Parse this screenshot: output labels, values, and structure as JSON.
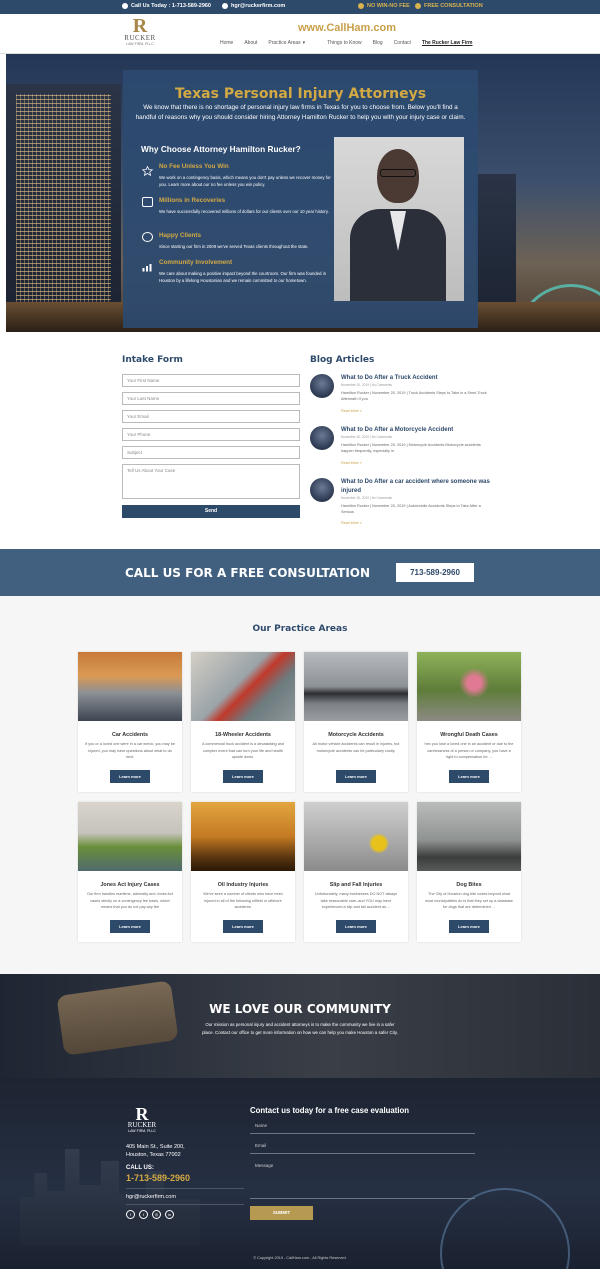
{
  "topbar": {
    "call_today": "Call Us Today : 1-713-589-2960",
    "email": "hgr@ruckerfirm.com",
    "no_win": "NO WIN-NO FEE",
    "free_consult": "FREE CONSULTATION"
  },
  "header": {
    "logo_mark": "R",
    "logo_name": "RUCKER",
    "logo_sub": "LAW FIRM, PLLC",
    "site": "www.CallHam.com",
    "nav": [
      "Home",
      "About",
      "Practice Areas",
      "Things to Know",
      "Blog",
      "Contact",
      "The Rucker Law Firm"
    ],
    "nav_caret": "▾"
  },
  "hero": {
    "title": "Texas Personal Injury Attorneys",
    "intro": "We know that there is no shortage of personal injury law firms in Texas for you to choose from. Below you'll find a handful of reasons why you should consider hiring Attorney Hamilton Rucker to help you with your injury case or claim.",
    "why": "Why Choose Attorney Hamilton Rucker?",
    "features": [
      {
        "title": "No Fee Unless You Win",
        "desc": "We work on a contingency basis, which means you don't pay unless we recover money for you. Learn more about our no fee unless you win policy."
      },
      {
        "title": "Millions in Recoveries",
        "desc": "We have successfully recovered millions of dollars for our clients over our 10 year history."
      },
      {
        "title": "Happy Clients",
        "desc": "Since starting our firm in 2009 we've served Texas clients throughout the state."
      },
      {
        "title": "Community Involvement",
        "desc": "We care about making a positive impact beyond the courtroom. Our firm was founded in Houston by a lifelong Houstonian and we remain committed to our hometown."
      }
    ]
  },
  "intake": {
    "heading": "Intake Form",
    "first_name": "Your First Name",
    "last_name": "Your Last Name",
    "email": "Your Email",
    "phone": "Your Phone",
    "subject": "Subject",
    "case": "Tell Us About Your Case",
    "send": "Send"
  },
  "blog": {
    "heading": "Blog Articles",
    "posts": [
      {
        "title": "What to Do After a Truck Accident",
        "meta": "November 20, 2019 | No Comments",
        "excerpt": "Hamilton Rucker | November 20, 2019 | Truck Accidents Steps to Take in a Semi-Truck Aftermath If you",
        "read": "Read More »"
      },
      {
        "title": "What to Do After a Motorcycle Accident",
        "meta": "November 20, 2019 | No Comments",
        "excerpt": "Hamilton Rucker | November 20, 2019 | Motorcycle Accidents Motorcycle accidents happen frequently, especially in",
        "read": "Read More »"
      },
      {
        "title": "What to Do After a car accident where someone was injured",
        "meta": "November 20, 2019 | No Comments",
        "excerpt": "Hamilton Rucker | November 20, 2019 | Automobile Accidents Steps to Take After a Serious",
        "read": "Read More »"
      }
    ]
  },
  "cta": {
    "text": "CALL US FOR A FREE CONSULTATION",
    "phone": "713-589-2960"
  },
  "practice": {
    "heading": "Our Practice Areas",
    "cards": [
      {
        "name": "Car Accidents",
        "desc": "If you or a loved one were in a car wreck, you may be injured, you may have questions about what to do next.",
        "btn": "Learn more"
      },
      {
        "name": "18-Wheeler Accidents",
        "desc": "A commercial truck accident is a devastating and complex event that can turn your life and health upside down.",
        "btn": "Learn more"
      },
      {
        "name": "Motorcycle Accidents",
        "desc": "All motor vehicle accidents can result in injuries, but motorcycle accidents can be particularly costly.",
        "btn": "Learn more"
      },
      {
        "name": "Wrongful Death Cases",
        "desc": "hen you lose a loved one in an accident or due to the carelessness of a person or company, you have a right to compensation for ...",
        "btn": "Learn more"
      },
      {
        "name": "Jones Act Injury Cases",
        "desc": "Our firm handles maritime, admiralty and Jones Act cases strictly on a contingency fee basis, which means that you do not pay any fee",
        "btn": "Learn more"
      },
      {
        "name": "Oil Industry Injuries",
        "desc": "We've seen a number of clients who have been injured in all of the following oilfield or offshore accidents:",
        "btn": "Learn more"
      },
      {
        "name": "Slip and Fall Injuries",
        "desc": "Unfortunately, many businesses DO NOT always take reasonable care–and YOU may have experienced a slip and fall accident as ...",
        "btn": "Learn more"
      },
      {
        "name": "Dog Bites",
        "desc": "The City of Houston dog bite codes beyond what most municipalities do is that they set up a database for dogs that are determined ...",
        "btn": "Learn more"
      }
    ]
  },
  "community": {
    "title": "WE LOVE OUR COMMUNITY",
    "desc": "Our mission as personal injury and accident attorneys is to make the community we live in a safer place. Contact our office to get more information on how we can help you make Houston a safer City."
  },
  "footer": {
    "logo_mark": "R",
    "logo_name": "RUCKER",
    "logo_sub": "LAW FIRM, PLLC",
    "address1": "405 Main St., Suite 200,",
    "address2": "Houston, Texas 77002",
    "call_label": "CALL US:",
    "phone": "1-713-589-2960",
    "email": "hgr@ruckerfirm.com",
    "social": [
      "f",
      "t",
      "◎",
      "in"
    ],
    "contact_heading": "Contact us today for a free case evaluation",
    "name_ph": "Name",
    "email_ph": "Email",
    "message_ph": "Message",
    "submit": "SUBMIT",
    "copyright": "© Copyright 2019 - CallHam.com - All Rights Reserved."
  }
}
